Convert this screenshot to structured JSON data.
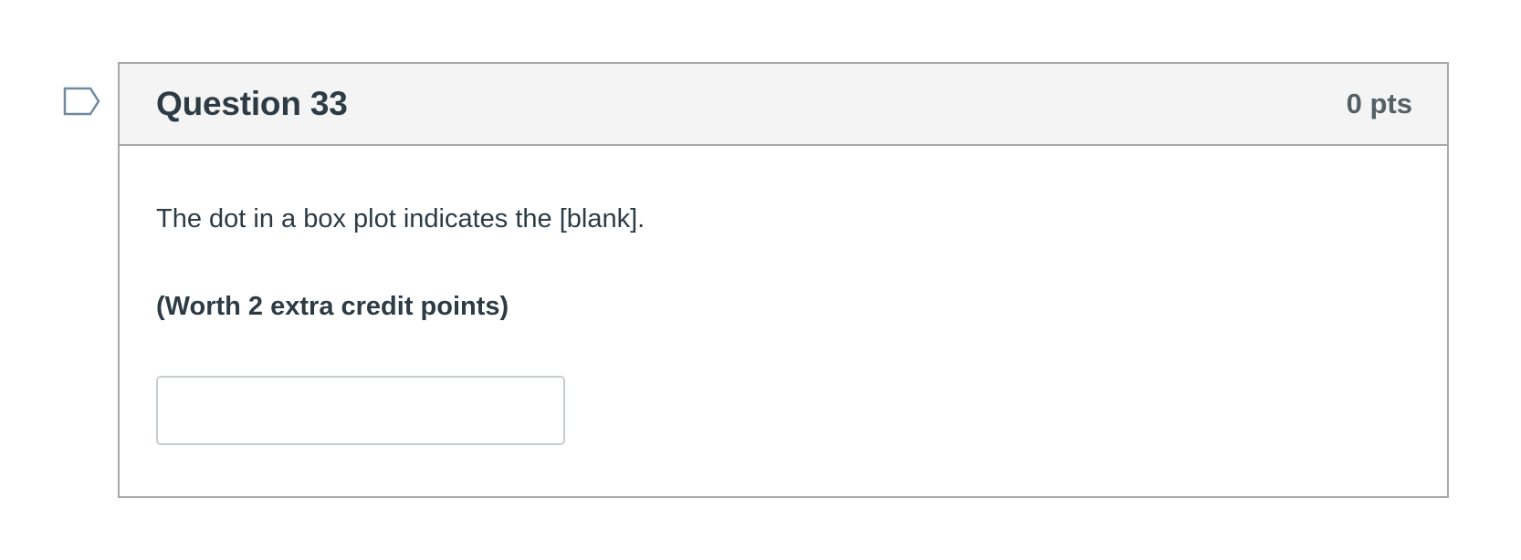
{
  "question": {
    "flag_icon": "flag-outline-icon",
    "title": "Question 33",
    "points": "0 pts",
    "text": "The dot in a box plot indicates the [blank].",
    "note": "(Worth 2 extra credit points)",
    "answer": {
      "value": "",
      "placeholder": ""
    }
  },
  "colors": {
    "header_bg": "#f4f4f4",
    "border": "#a8a8a8",
    "text": "#2d3b45",
    "points_text": "#545f66",
    "flag_stroke": "#6f8aa1",
    "input_border": "#c7cdd1"
  }
}
